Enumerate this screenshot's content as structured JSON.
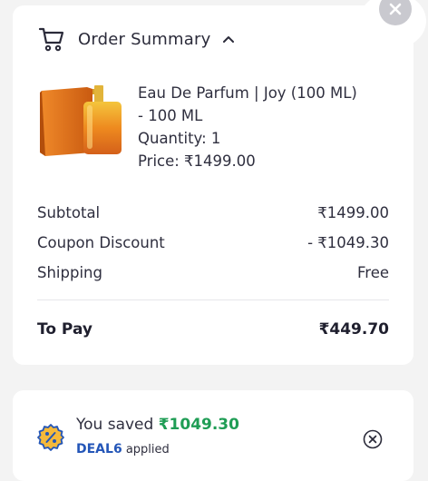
{
  "header": {
    "title": "Order Summary",
    "cart_icon": "cart-icon",
    "toggle_icon": "chevron-up-icon",
    "close_icon": "close-icon"
  },
  "product": {
    "name_line1": "Eau De Parfum | Joy (100 ML)",
    "name_line2": "- 100 ML",
    "quantity": "Quantity: 1",
    "price": "Price: ₹1499.00"
  },
  "summary": {
    "subtotal_label": "Subtotal",
    "subtotal_value": "₹1499.00",
    "discount_label": "Coupon Discount",
    "discount_value": "- ₹1049.30",
    "shipping_label": "Shipping",
    "shipping_value": "Free",
    "total_label": "To Pay",
    "total_value": "₹449.70"
  },
  "savings": {
    "prefix": "You saved",
    "amount": "₹1049.30",
    "code": "DEAL6",
    "applied_text": "applied",
    "icon": "discount-badge-icon",
    "remove_icon": "remove-coupon-icon"
  },
  "colors": {
    "savings_green": "#1f9d55",
    "code_blue": "#2456b8",
    "bottle_orange": "#e8731a"
  }
}
